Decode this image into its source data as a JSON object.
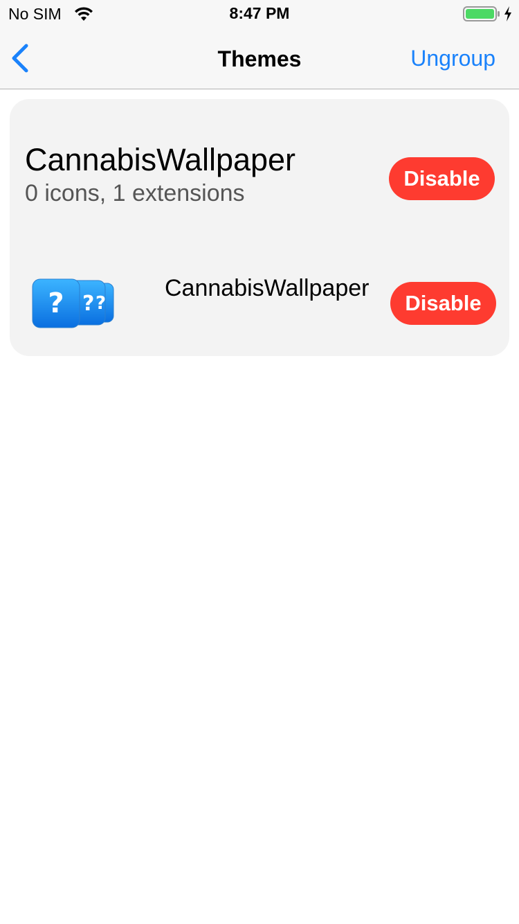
{
  "status_bar": {
    "carrier": "No SIM",
    "time": "8:47 PM",
    "wifi_icon": "wifi-icon",
    "battery_icon": "battery-icon",
    "battery_color": "#4cd964",
    "charging_icon": "bolt-icon"
  },
  "nav": {
    "back_icon": "chevron-left-icon",
    "title": "Themes",
    "right_action": "Ungroup",
    "accent_color": "#1a82fb"
  },
  "group": {
    "title": "CannabisWallpaper",
    "subtitle": "0 icons, 1 extensions",
    "button_label": "Disable",
    "button_color": "#fe3b30"
  },
  "items": [
    {
      "icon": "question-mark-app-icon",
      "name": "CannabisWallpaper",
      "button_label": "Disable"
    }
  ]
}
